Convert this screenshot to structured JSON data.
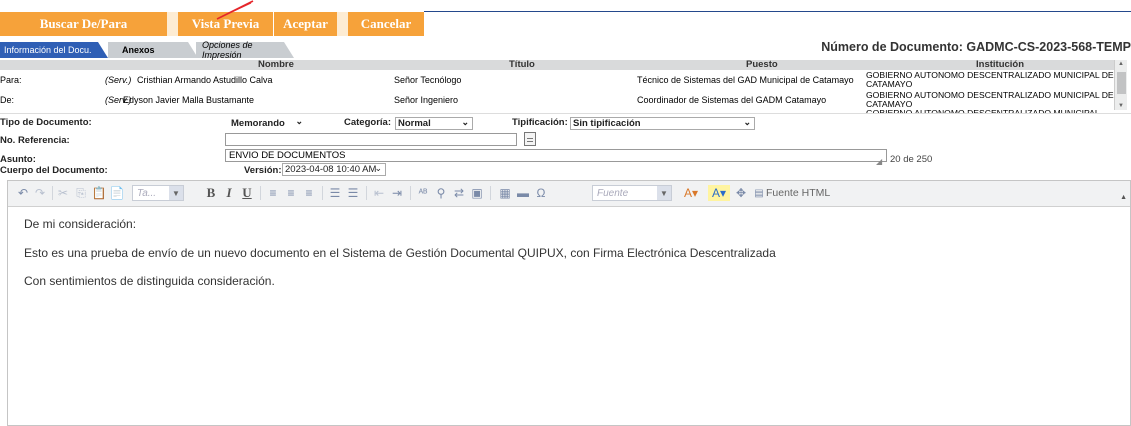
{
  "toolbar": {
    "buscar_label": "Buscar De/Para",
    "vista_label": "Vista Previa",
    "aceptar_label": "Aceptar",
    "cancelar_label": "Cancelar"
  },
  "tabs": {
    "info": "Información del Docu.",
    "anexos": "Anexos",
    "opciones": "Opciones de Impresión"
  },
  "document_number": "Número de Documento: GADMC-CS-2023-568-TEMP",
  "recipients": {
    "headers": {
      "nombre": "Nombre",
      "titulo": "Título",
      "puesto": "Puesto",
      "institucion": "Institución"
    },
    "rows": [
      {
        "role": "Para:",
        "tag": "(Serv.)",
        "nombre": "Cristhian Armando Astudillo Calva",
        "titulo": "Señor Tecnólogo",
        "puesto": "Técnico de Sistemas del GAD Municipal de Catamayo",
        "institucion": "GOBIERNO AUTONOMO DESCENTRALIZADO MUNICIPAL DE CATAMAYO"
      },
      {
        "role": "De:",
        "tag": "(Serv.)",
        "nombre": "Edyson Javier Malla Bustamante",
        "titulo": "Señor Ingeniero",
        "puesto": "Coordinador de Sistemas del GADM Catamayo",
        "institucion": "GOBIERNO AUTONOMO DESCENTRALIZADO MUNICIPAL DE CATAMAYO"
      }
    ],
    "overflow_institucion": "GOBIERNO AUTONOMO DESCENTRALIZADO MUNICIPAL"
  },
  "form": {
    "tipo_label": "Tipo de Documento:",
    "tipo_value": "Memorando",
    "categoria_label": "Categoría:",
    "categoria_value": "Normal",
    "tipificacion_label": "Tipificación:",
    "tipificacion_value": "Sin tipificación",
    "referencia_label": "No. Referencia:",
    "referencia_value": "",
    "asunto_label": "Asunto:",
    "asunto_value": "ENVIO DE DOCUMENTOS",
    "asunto_count": "20 de 250",
    "cuerpo_label": "Cuerpo del Documento:",
    "version_label": "Versión:",
    "version_value": "2023-04-08 10:40 AM"
  },
  "editor": {
    "font_size_placeholder": "Ta...",
    "font_placeholder": "Fuente",
    "source_label": "Fuente HTML",
    "body": [
      "De mi consideración:",
      "Esto es una prueba de envío de un nuevo documento en el Sistema de Gestión Documental QUIPUX, con Firma Electrónica Descentralizada",
      "Con sentimientos de distinguida consideración."
    ]
  },
  "colors": {
    "button_orange": "#f6a23a",
    "tab_active_blue": "#2f5fb5",
    "annotation_arrow": "#e5262b"
  }
}
